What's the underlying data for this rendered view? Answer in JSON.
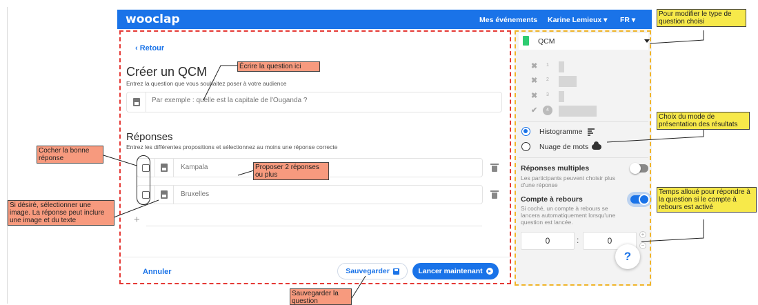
{
  "topbar": {
    "logo": "wooclap",
    "nav_events": "Mes événements",
    "nav_user": "Karine Lemieux ▾",
    "nav_lang": "FR ▾",
    "color": "#1a73e8"
  },
  "editor": {
    "back_label": "‹  Retour",
    "title": "Créer un QCM",
    "subtitle": "Entrez la question que vous souhaitez poser à votre audience",
    "question_placeholder": "Par exemple : quelle est la capitale de l'Ouganda ?",
    "responses_title": "Réponses",
    "responses_subtitle": "Entrez les différentes propositions et sélectionnez au moins une réponse correcte",
    "answers": [
      {
        "placeholder": "Kampala"
      },
      {
        "placeholder": "Bruxelles"
      }
    ],
    "add_label": "+",
    "cancel_label": "Annuler",
    "save_label": "Sauvegarder",
    "launch_label": "Lancer maintenant"
  },
  "settings": {
    "question_type": "QCM",
    "preview_rows": [
      "1",
      "2",
      "3",
      "4"
    ],
    "display_modes": [
      {
        "label": "Histogramme",
        "selected": true,
        "icon": "histogram-icon"
      },
      {
        "label": "Nuage de mots",
        "selected": false,
        "icon": "cloud-icon"
      }
    ],
    "multiple": {
      "title": "Réponses multiples",
      "desc": "Les participants peuvent choisir plus d'une réponse",
      "enabled": false
    },
    "countdown": {
      "title": "Compte à rebours",
      "desc": "Si coché, un compte à rebours se lancera automatiquement lorsqu'une question est lancée.",
      "enabled": true,
      "minutes": "0",
      "seconds": "0"
    },
    "help_label": "?"
  },
  "annotations": {
    "write_question": "Écrire la question ici",
    "check_answer": "Cocher la bonne réponse",
    "propose_answers": "Proposer 2 réponses ou plus",
    "image_answer": "Si désiré, sélectionner une image. La réponse peut inclure une image et du texte",
    "save_question": "Sauvegarder la question",
    "change_type": "Pour modifier le type de question choisi",
    "display_mode": "Choix du mode de présentation des résultats",
    "time_allowed": "Temps alloué pour répondre à la question si le compte à rebours est activé"
  }
}
